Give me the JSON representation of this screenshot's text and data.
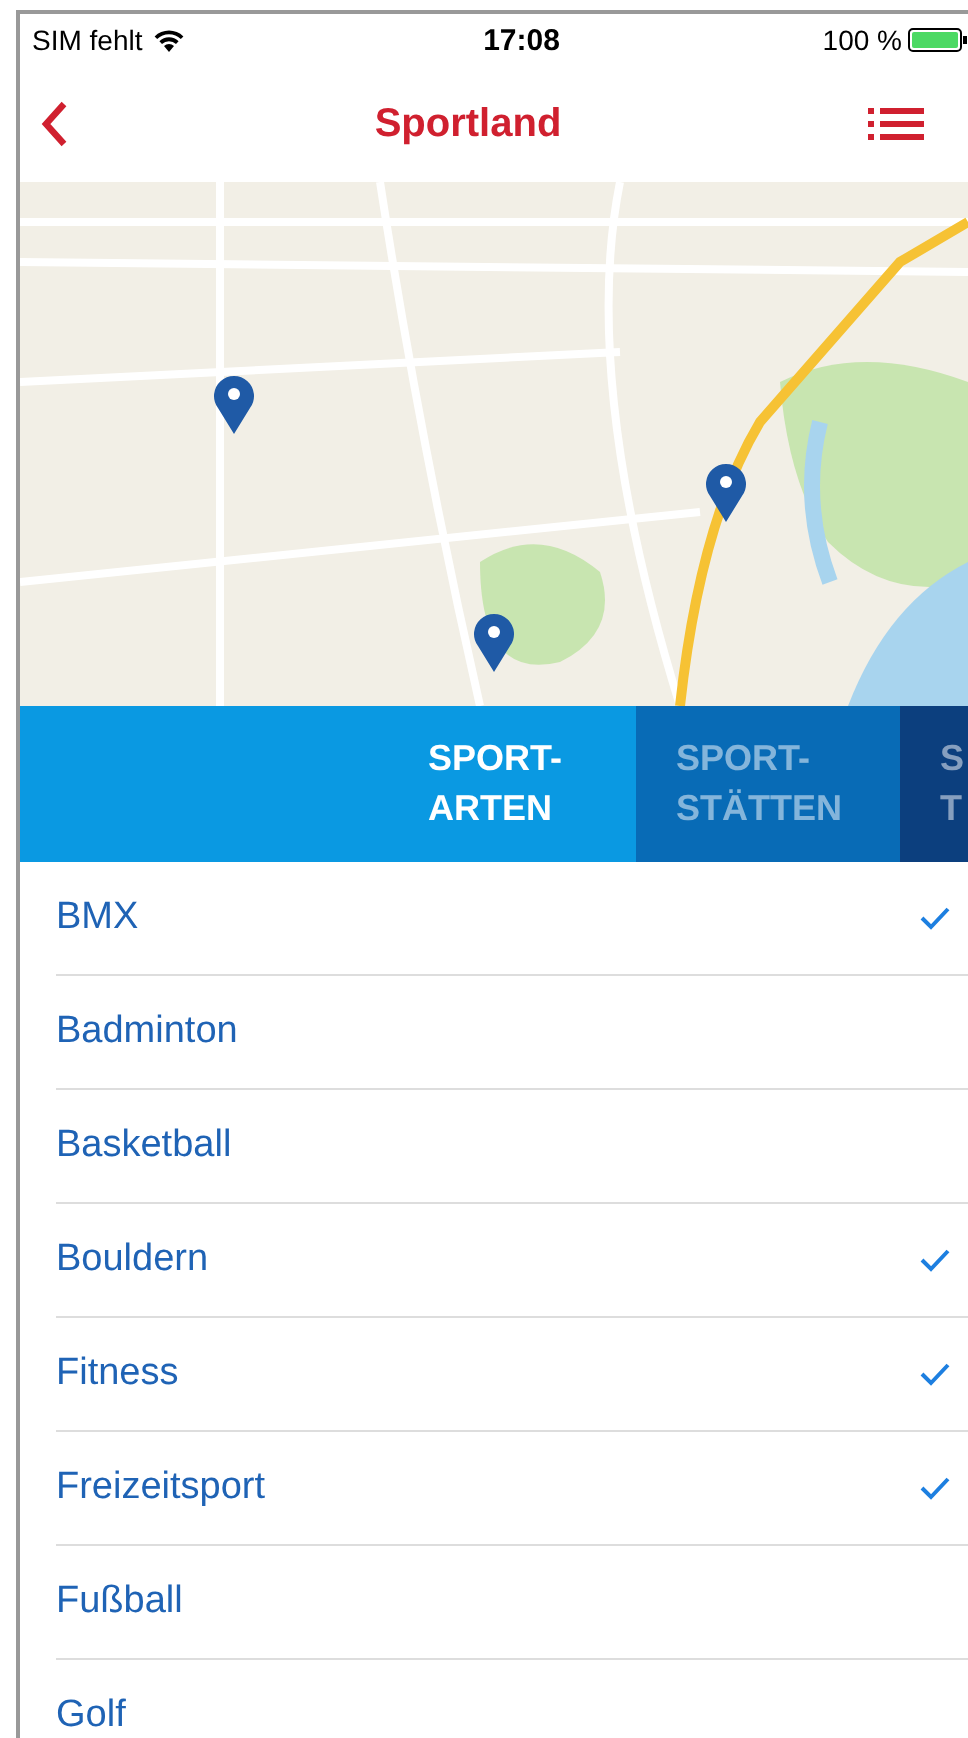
{
  "status_bar": {
    "carrier": "SIM fehlt",
    "time": "17:08",
    "battery": "100 %"
  },
  "nav_bar": {
    "title": "Sportland"
  },
  "tabs": [
    {
      "lines": [
        "SPORT-",
        "ARTEN"
      ],
      "selected": true
    },
    {
      "lines": [
        "SPORT-",
        "STÄTTEN"
      ],
      "selected": false
    },
    {
      "lines": [
        "S",
        "T"
      ],
      "selected": false
    }
  ],
  "list": [
    {
      "label": "BMX",
      "checked": true
    },
    {
      "label": "Badminton",
      "checked": false
    },
    {
      "label": "Basketball",
      "checked": false
    },
    {
      "label": "Bouldern",
      "checked": true
    },
    {
      "label": "Fitness",
      "checked": true
    },
    {
      "label": "Freizeitsport",
      "checked": true
    },
    {
      "label": "Fußball",
      "checked": false
    },
    {
      "label": "Golf",
      "checked": false
    }
  ]
}
